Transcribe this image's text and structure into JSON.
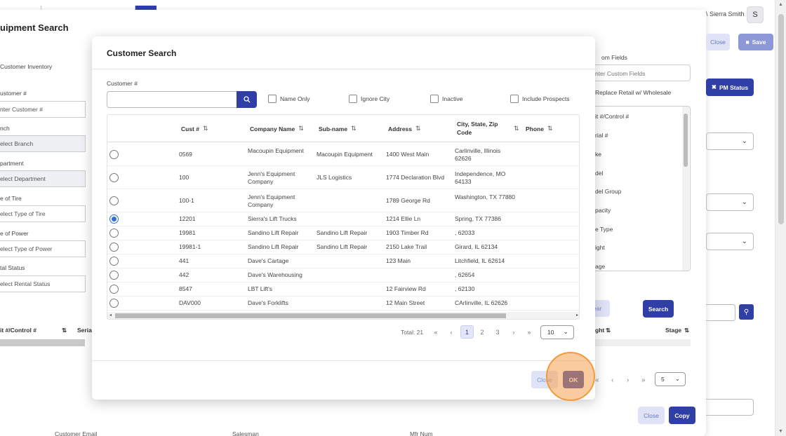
{
  "header": {
    "user_name": "\\ Sierra Smith",
    "avatar_initial": "S"
  },
  "equipment_search": {
    "title": "uipment Search",
    "customer_inventory_label": "Customer Inventory",
    "fields": [
      {
        "label": "ustomer #",
        "value": "nter Customer #",
        "grey": false
      },
      {
        "label": "nch",
        "value": "elect Branch",
        "grey": true
      },
      {
        "label": "partment",
        "value": "elect Department",
        "grey": true
      },
      {
        "label": "e of Tire",
        "value": "elect Type of Tire",
        "grey": false
      },
      {
        "label": "e of Power",
        "value": "elect Type of Power",
        "grey": false
      },
      {
        "label": "tal Status",
        "value": "elect Rental Status",
        "grey": false
      }
    ],
    "close_label": "Close",
    "save_label": "Save",
    "custom_fields_label": "om Fields",
    "custom_fields_placeholder": "nter Custom Fields",
    "replace_label": "Replace Retail w/ Wholesale",
    "pm_status_label": "PM Status",
    "custom_field_options": [
      "it #/Control #",
      "rial #",
      "ke",
      "del",
      "del Group",
      "pacity",
      "e Type",
      "ight",
      "age"
    ],
    "clear_label": "ear",
    "search_label": "Search",
    "grid_left_columns": [
      "it #/Control #",
      "Serial"
    ],
    "grid_right_columns": [
      "ght",
      "Stage"
    ],
    "page_size": "5",
    "bottom_close_label": "Close",
    "bottom_copy_label": "Copy",
    "bottom_partial_labels": [
      "Customer Email",
      "Salesman",
      "Mfr Num"
    ]
  },
  "customer_search": {
    "title": "Customer Search",
    "customer_label": "Customer #",
    "customer_value": "",
    "checkboxes": [
      "Name Only",
      "Ignore City",
      "Inactive",
      "Include Prospects"
    ],
    "columns": {
      "cust": "Cust #",
      "company": "Company Name",
      "subname": "Sub-name",
      "address": "Address",
      "city": "City, State, Zip Code",
      "phone": "Phone"
    },
    "rows": [
      {
        "cust": "0569",
        "company": "Macoupin Equipment",
        "subname": "Macoupin Equipment",
        "address": "1400 West Main",
        "city": "Carlinville, Illinois 62626",
        "selected": false
      },
      {
        "cust": "100",
        "company": "Jenn's Equipment Company",
        "subname": "JLS Logistics",
        "address": "1774 Declaration Blvd",
        "city": "Independence, MO 64133",
        "selected": false
      },
      {
        "cust": "100-1",
        "company": "Jenn's Equipment Company",
        "subname": "",
        "address": "1789 George Rd",
        "city": "Washington, TX 77880",
        "selected": false
      },
      {
        "cust": "12201",
        "company": "Sierra's Lift Trucks",
        "subname": "",
        "address": "1214 Ellie Ln",
        "city": "Spring, TX 77386",
        "selected": true
      },
      {
        "cust": "19981",
        "company": "Sandino Lift Repair",
        "subname": "Sandino Lift Repair",
        "address": "1903 Timber Rd",
        "city": ", 62033",
        "selected": false
      },
      {
        "cust": "19981-1",
        "company": "Sandino Lift Repair",
        "subname": "Sandino Lift Repair",
        "address": "2150 Lake Trail",
        "city": "Girard, IL 62134",
        "selected": false
      },
      {
        "cust": "441",
        "company": "Dave's Cartage",
        "subname": "",
        "address": "123 Main",
        "city": "Litchfield, IL 62614",
        "selected": false
      },
      {
        "cust": "442",
        "company": "Dave's Warehousing",
        "subname": "",
        "address": "",
        "city": ", 62654",
        "selected": false
      },
      {
        "cust": "8547",
        "company": "LBT Lift's",
        "subname": "",
        "address": "12 Fairview Rd",
        "city": ", 62130",
        "selected": false
      },
      {
        "cust": "DAV000",
        "company": "Dave's Forklifts",
        "subname": "",
        "address": "12 Main Street",
        "city": "CArlinville, IL 62626",
        "selected": false
      }
    ],
    "pagination": {
      "total_label": "Total: 21",
      "first": "«",
      "prev": "‹",
      "pages": [
        "1",
        "2",
        "3"
      ],
      "next": "›",
      "last": "»",
      "page_size": "10"
    },
    "close_label": "Close",
    "ok_label": "OK"
  },
  "icons": {
    "search": "search-icon",
    "sort": "sort-icon",
    "chevron": "chevron-down-icon",
    "save": "floppy-icon",
    "pm": "wrench-icon"
  },
  "colors": {
    "primary": "#2f3fa6",
    "light_button": "#dfe3f5",
    "click_highlight": "#f29a3c"
  }
}
